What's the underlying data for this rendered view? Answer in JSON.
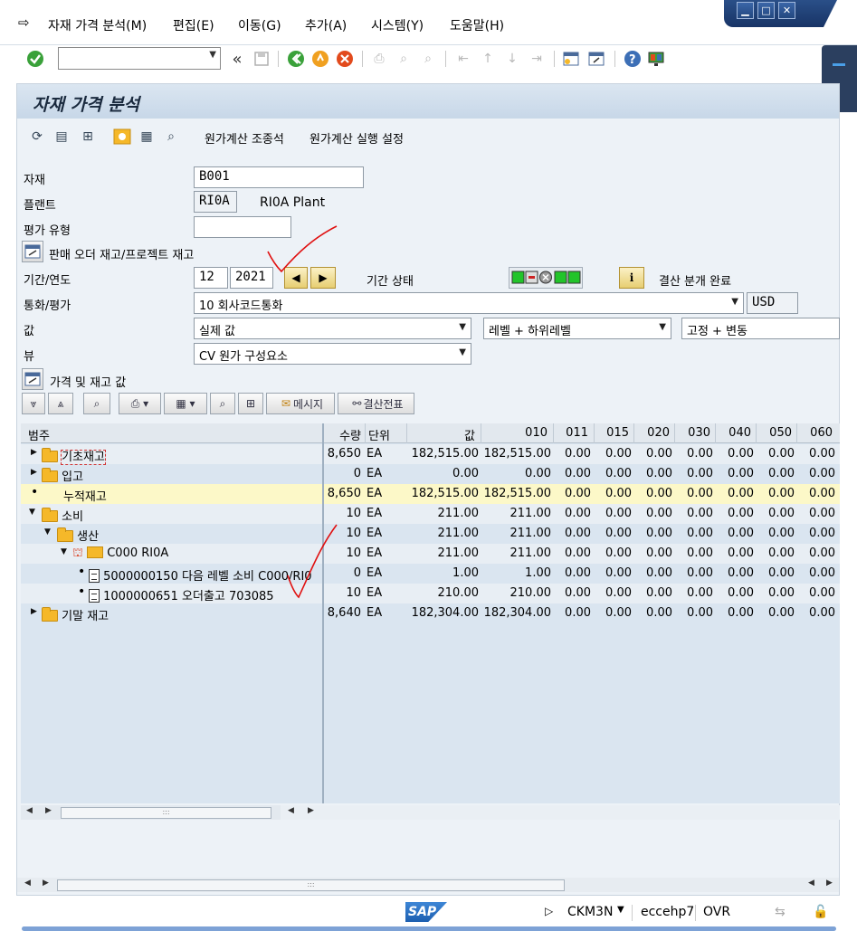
{
  "menu": [
    "자재 가격 분석(M)",
    "편집(E)",
    "이동(G)",
    "추가(A)",
    "시스템(Y)",
    "도움말(H)"
  ],
  "window_controls": {
    "minimize": "▁",
    "maximize": "□",
    "close": "✕"
  },
  "toolbar": {
    "command_value": "",
    "back_label": "«"
  },
  "title": "자재 가격 분석",
  "app_toolbar": {
    "cost_browser": "원가계산 조종석",
    "cost_run_settings": "원가계산 실행 설정"
  },
  "header": {
    "material_label": "자재",
    "material_value": "B001",
    "plant_label": "플랜트",
    "plant_value": "RI0A",
    "plant_desc": "RI0A Plant",
    "valuation_type_label": "평가 유형",
    "valuation_type_value": "",
    "sales_order_toggle": "판매 오더 재고/프로젝트 재고",
    "period_label": "기간/연도",
    "period_value": "12",
    "year_value": "2021",
    "period_status_label": "기간 상태",
    "period_status_text": "결산 분개 완료",
    "currency_label": "통화/평가",
    "currency_value": "10 회사코드통화",
    "currency_code": "USD",
    "value_label": "값",
    "value_select": "실제 값",
    "level_select": "레벨 + 하위레벨",
    "fixvar_select": "고정 + 변동",
    "view_label": "뷰",
    "view_select": "CV 원가 구성요소",
    "price_stock_toggle": "가격 및 재고 값"
  },
  "alv_toolbar": {
    "messages": "메시지",
    "closing_entry": "결산전표"
  },
  "grid": {
    "columns": [
      "범주",
      "수량",
      "단위",
      "값",
      "010",
      "011",
      "015",
      "020",
      "030",
      "040",
      "050",
      "060"
    ],
    "rows": [
      {
        "cat": "기초재고",
        "qty": "8,650",
        "unit": "EA",
        "val": "182,515.00",
        "c010": "182,515.00",
        "rest": [
          "0.00",
          "0.00",
          "0.00",
          "0.00",
          "0.00",
          "0.00",
          "0.00"
        ]
      },
      {
        "cat": "입고",
        "qty": "0",
        "unit": "EA",
        "val": "0.00",
        "c010": "0.00",
        "rest": [
          "0.00",
          "0.00",
          "0.00",
          "0.00",
          "0.00",
          "0.00",
          "0.00"
        ]
      },
      {
        "cat": "누적재고",
        "qty": "8,650",
        "unit": "EA",
        "val": "182,515.00",
        "c010": "182,515.00",
        "rest": [
          "0.00",
          "0.00",
          "0.00",
          "0.00",
          "0.00",
          "0.00",
          "0.00"
        ]
      },
      {
        "cat": "소비",
        "qty": "10",
        "unit": "EA",
        "val": "211.00",
        "c010": "211.00",
        "rest": [
          "0.00",
          "0.00",
          "0.00",
          "0.00",
          "0.00",
          "0.00",
          "0.00"
        ]
      },
      {
        "cat": "생산",
        "qty": "10",
        "unit": "EA",
        "val": "211.00",
        "c010": "211.00",
        "rest": [
          "0.00",
          "0.00",
          "0.00",
          "0.00",
          "0.00",
          "0.00",
          "0.00"
        ]
      },
      {
        "cat": "C000 RI0A",
        "qty": "10",
        "unit": "EA",
        "val": "211.00",
        "c010": "211.00",
        "rest": [
          "0.00",
          "0.00",
          "0.00",
          "0.00",
          "0.00",
          "0.00",
          "0.00"
        ]
      },
      {
        "cat": "5000000150 다음 레벨 소비 C000/RI0",
        "qty": "0",
        "unit": "EA",
        "val": "1.00",
        "c010": "1.00",
        "rest": [
          "0.00",
          "0.00",
          "0.00",
          "0.00",
          "0.00",
          "0.00",
          "0.00"
        ]
      },
      {
        "cat": "1000000651 오더출고 703085",
        "qty": "10",
        "unit": "EA",
        "val": "210.00",
        "c010": "210.00",
        "rest": [
          "0.00",
          "0.00",
          "0.00",
          "0.00",
          "0.00",
          "0.00",
          "0.00"
        ]
      },
      {
        "cat": "기말 재고",
        "qty": "8,640",
        "unit": "EA",
        "val": "182,304.00",
        "c010": "182,304.00",
        "rest": [
          "0.00",
          "0.00",
          "0.00",
          "0.00",
          "0.00",
          "0.00",
          "0.00"
        ]
      }
    ]
  },
  "statusbar": {
    "logo": "SAP",
    "transaction": "CKM3N",
    "server": "eccehp7",
    "mode": "OVR"
  },
  "colors": {
    "title_bg": "#c7d7e8",
    "highlight_row": "#fcf8c8",
    "accent": "#1d5fb0"
  }
}
